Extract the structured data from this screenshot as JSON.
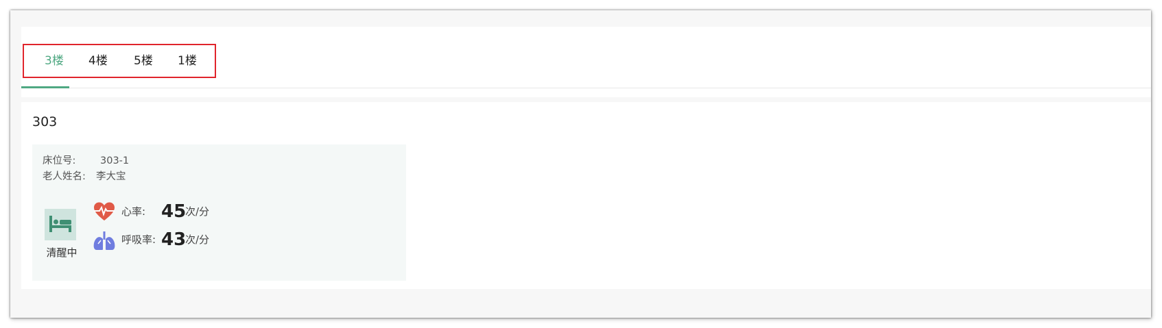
{
  "floor_tabs": [
    {
      "label": "3楼",
      "active": true
    },
    {
      "label": "4楼",
      "active": false
    },
    {
      "label": "5楼",
      "active": false
    },
    {
      "label": "1楼",
      "active": false
    }
  ],
  "room": {
    "number": "303",
    "bed": {
      "bed_label": "床位号:",
      "bed_number": "303-1",
      "name_label": "老人姓名:",
      "name": "李大宝",
      "status_icon": "bed-icon",
      "status_text": "清醒中",
      "heart_rate": {
        "icon": "heart-rate-icon",
        "label": "心率:",
        "value": "45",
        "unit": "次/分"
      },
      "respiration_rate": {
        "icon": "lungs-icon",
        "label": "呼吸率:",
        "value": "43",
        "unit": "次/分"
      }
    }
  },
  "colors": {
    "accent": "#4fa882",
    "highlight_border": "#e0242b",
    "heart": "#e05a47",
    "lungs": "#6f7ddf",
    "status_bg": "#cfe4de"
  }
}
